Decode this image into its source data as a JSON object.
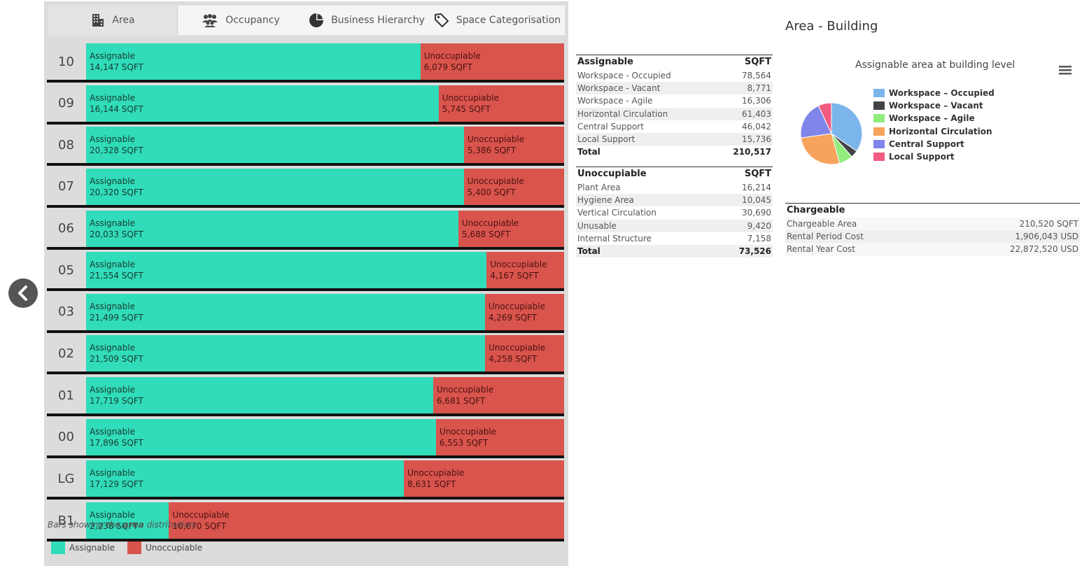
{
  "tabs": [
    {
      "label": "Area",
      "icon": "building-icon"
    },
    {
      "label": "Occupancy",
      "icon": "people-icon"
    },
    {
      "label": "Business Hierarchy",
      "icon": "pie-icon"
    },
    {
      "label": "Space Categorisation",
      "icon": "tag-icon"
    }
  ],
  "floors": [
    {
      "level": "10",
      "assignable_label": "Assignable",
      "assignable_value": "14,147 SQFT",
      "unocc_label": "Unoccupiable",
      "unocc_value": "6,079 SQFT",
      "assignable": 14147,
      "unocc": 6079
    },
    {
      "level": "09",
      "assignable_label": "Assignable",
      "assignable_value": "16,144 SQFT",
      "unocc_label": "Unoccupiable",
      "unocc_value": "5,745 SQFT",
      "assignable": 16144,
      "unocc": 5745
    },
    {
      "level": "08",
      "assignable_label": "Assignable",
      "assignable_value": "20,328 SQFT",
      "unocc_label": "Unoccupiable",
      "unocc_value": "5,386 SQFT",
      "assignable": 20328,
      "unocc": 5386
    },
    {
      "level": "07",
      "assignable_label": "Assignable",
      "assignable_value": "20,320 SQFT",
      "unocc_label": "Unoccupiable",
      "unocc_value": "5,400 SQFT",
      "assignable": 20320,
      "unocc": 5400
    },
    {
      "level": "06",
      "assignable_label": "Assignable",
      "assignable_value": "20,033 SQFT",
      "unocc_label": "Unoccupiable",
      "unocc_value": "5,688 SQFT",
      "assignable": 20033,
      "unocc": 5688
    },
    {
      "level": "05",
      "assignable_label": "Assignable",
      "assignable_value": "21,554 SQFT",
      "unocc_label": "Unoccupiable",
      "unocc_value": "4,167 SQFT",
      "assignable": 21554,
      "unocc": 4167
    },
    {
      "level": "03",
      "assignable_label": "Assignable",
      "assignable_value": "21,499 SQFT",
      "unocc_label": "Unoccupiable",
      "unocc_value": "4,269 SQFT",
      "assignable": 21499,
      "unocc": 4269
    },
    {
      "level": "02",
      "assignable_label": "Assignable",
      "assignable_value": "21,509 SQFT",
      "unocc_label": "Unoccupiable",
      "unocc_value": "4,258 SQFT",
      "assignable": 21509,
      "unocc": 4258
    },
    {
      "level": "01",
      "assignable_label": "Assignable",
      "assignable_value": "17,719 SQFT",
      "unocc_label": "Unoccupiable",
      "unocc_value": "6,681 SQFT",
      "assignable": 17719,
      "unocc": 6681
    },
    {
      "level": "00",
      "assignable_label": "Assignable",
      "assignable_value": "17,896 SQFT",
      "unocc_label": "Unoccupiable",
      "unocc_value": "6,553 SQFT",
      "assignable": 17896,
      "unocc": 6553
    },
    {
      "level": "LG",
      "assignable_label": "Assignable",
      "assignable_value": "17,129 SQFT",
      "unocc_label": "Unoccupiable",
      "unocc_value": "8,631 SQFT",
      "assignable": 17129,
      "unocc": 8631
    },
    {
      "level": "B1",
      "assignable_label": "Assignable",
      "assignable_value": "2,238 SQFT",
      "unocc_label": "Unoccupiable",
      "unocc_value": "10,670 SQFT",
      "assignable": 2238,
      "unocc": 10670
    }
  ],
  "caption": {
    "prefix": "Bars showing the ",
    "bold": "area",
    "suffix": " distribution."
  },
  "legend": [
    {
      "label": "Assignable",
      "color": "#30dcb9"
    },
    {
      "label": "Unoccupiable",
      "color": "#d9544d"
    }
  ],
  "assignable_table": {
    "title": "Assignable",
    "unit": "SQFT",
    "rows": [
      {
        "label": "Workspace - Occupied",
        "value": "78,564"
      },
      {
        "label": "Workspace - Vacant",
        "value": "8,771"
      },
      {
        "label": "Workspace - Agile",
        "value": "16,306"
      },
      {
        "label": "Horizontal Circulation",
        "value": "61,403"
      },
      {
        "label": "Central Support",
        "value": "46,042"
      },
      {
        "label": "Local Support",
        "value": "15,736"
      }
    ],
    "total_label": "Total",
    "total_value": "210,517"
  },
  "unocc_table": {
    "title": "Unoccupiable",
    "unit": "SQFT",
    "rows": [
      {
        "label": "Plant Area",
        "value": "16,214"
      },
      {
        "label": "Hygiene Area",
        "value": "10,045"
      },
      {
        "label": "Vertical Circulation",
        "value": "30,690"
      },
      {
        "label": "Unusable",
        "value": "9,420"
      },
      {
        "label": "Internal Structure",
        "value": "7,158"
      }
    ],
    "total_label": "Total",
    "total_value": "73,526"
  },
  "chart": {
    "title": "Area - Building",
    "subtitle": "Assignable area at building level"
  },
  "chart_data": {
    "type": "pie",
    "title": "Assignable area at building level",
    "slices": [
      {
        "name": "Workspace – Occupied",
        "value": 78564,
        "color": "#7cb5ec"
      },
      {
        "name": "Workspace – Vacant",
        "value": 8771,
        "color": "#434348"
      },
      {
        "name": "Workspace – Agile",
        "value": 16306,
        "color": "#90ed7d"
      },
      {
        "name": "Horizontal Circulation",
        "value": 61403,
        "color": "#f7a35c"
      },
      {
        "name": "Central Support",
        "value": 46042,
        "color": "#8085e9"
      },
      {
        "name": "Local Support",
        "value": 15736,
        "color": "#f15c80"
      }
    ],
    "legend": "right"
  },
  "chargeable_table": {
    "title": "Chargeable",
    "rows": [
      {
        "label": "Chargeable Area",
        "value": "210,520 SQFT"
      },
      {
        "label": "Rental Period Cost",
        "value": "1,906,043 USD"
      },
      {
        "label": "Rental Year Cost",
        "value": "22,872,520 USD"
      }
    ]
  }
}
